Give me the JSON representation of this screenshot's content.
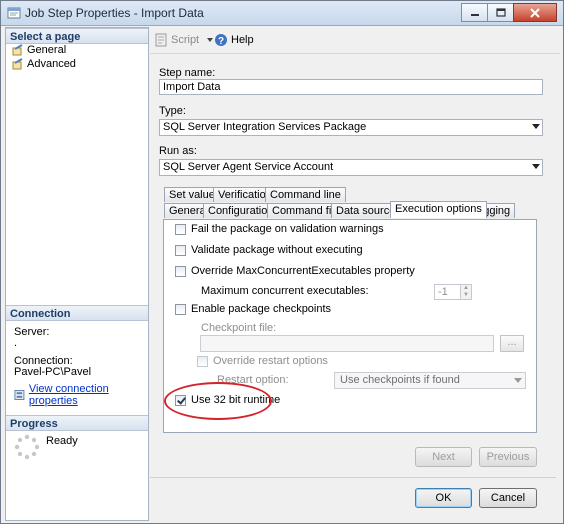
{
  "window": {
    "title": "Job Step Properties - Import Data",
    "minimize_icon": "minimize-icon",
    "maximize_icon": "maximize-icon",
    "close_icon": "close-icon"
  },
  "left": {
    "select_page_header": "Select a page",
    "pages": [
      "General",
      "Advanced"
    ],
    "connection_header": "Connection",
    "server_label": "Server:",
    "server_value": ".",
    "connection_label": "Connection:",
    "connection_value": "Pavel-PC\\Pavel",
    "view_connection_link": "View connection properties",
    "progress_header": "Progress",
    "progress_status": "Ready"
  },
  "toolbar": {
    "script_label": "Script",
    "help_label": "Help"
  },
  "form": {
    "step_name_label": "Step name:",
    "step_name_value": "Import Data",
    "type_label": "Type:",
    "type_value": "SQL Server Integration Services Package",
    "run_as_label": "Run as:",
    "run_as_value": "SQL Server Agent Service Account"
  },
  "tabs": {
    "row1": [
      "Set values",
      "Verification",
      "Command line"
    ],
    "row2": [
      "General",
      "Configurations",
      "Command files",
      "Data sources",
      "Execution options",
      "Logging"
    ],
    "active": "Execution options"
  },
  "options": {
    "fail_on_warnings": "Fail the package on validation warnings",
    "validate_without_executing": "Validate package without executing",
    "override_max_concurrent": "Override MaxConcurrentExecutables property",
    "max_concurrent_label": "Maximum concurrent executables:",
    "max_concurrent_value": "-1",
    "enable_checkpoints": "Enable package checkpoints",
    "checkpoint_file_label": "Checkpoint file:",
    "checkpoint_browse": "...",
    "override_restart": "Override restart options",
    "restart_option_label": "Restart option:",
    "restart_option_value": "Use checkpoints if found",
    "use_32bit": "Use 32 bit runtime",
    "use_32bit_checked": true
  },
  "nav": {
    "next": "Next",
    "previous": "Previous"
  },
  "buttons": {
    "ok": "OK",
    "cancel": "Cancel"
  },
  "colors": {
    "highlight_ellipse": "#d4242a",
    "link": "#0033cc"
  }
}
